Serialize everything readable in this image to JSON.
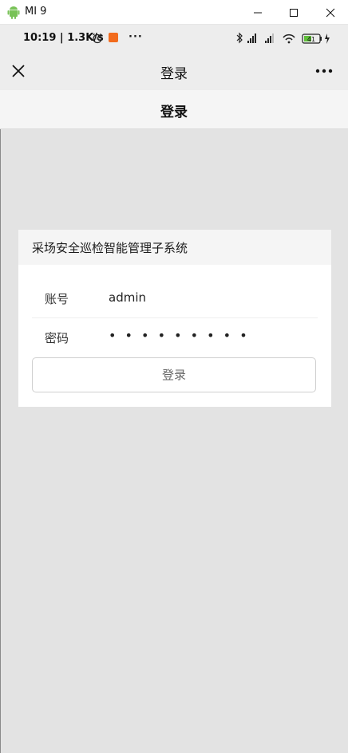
{
  "window": {
    "title": "MI 9"
  },
  "status_bar": {
    "time": "10:19",
    "speed": "1.3K/s",
    "more": "···",
    "battery": "41"
  },
  "nav": {
    "title": "登录"
  },
  "header": {
    "title": "登录"
  },
  "card": {
    "system_name": "采场安全巡检智能管理子系统",
    "account_label": "账号",
    "account_value": "admin",
    "password_label": "密码",
    "password_value": "• • • • • • • • •",
    "login_label": "登录"
  },
  "colors": {
    "background": "#e3e3e3",
    "bar": "#ededed",
    "card": "#ffffff",
    "badge": "#f26b1d"
  }
}
